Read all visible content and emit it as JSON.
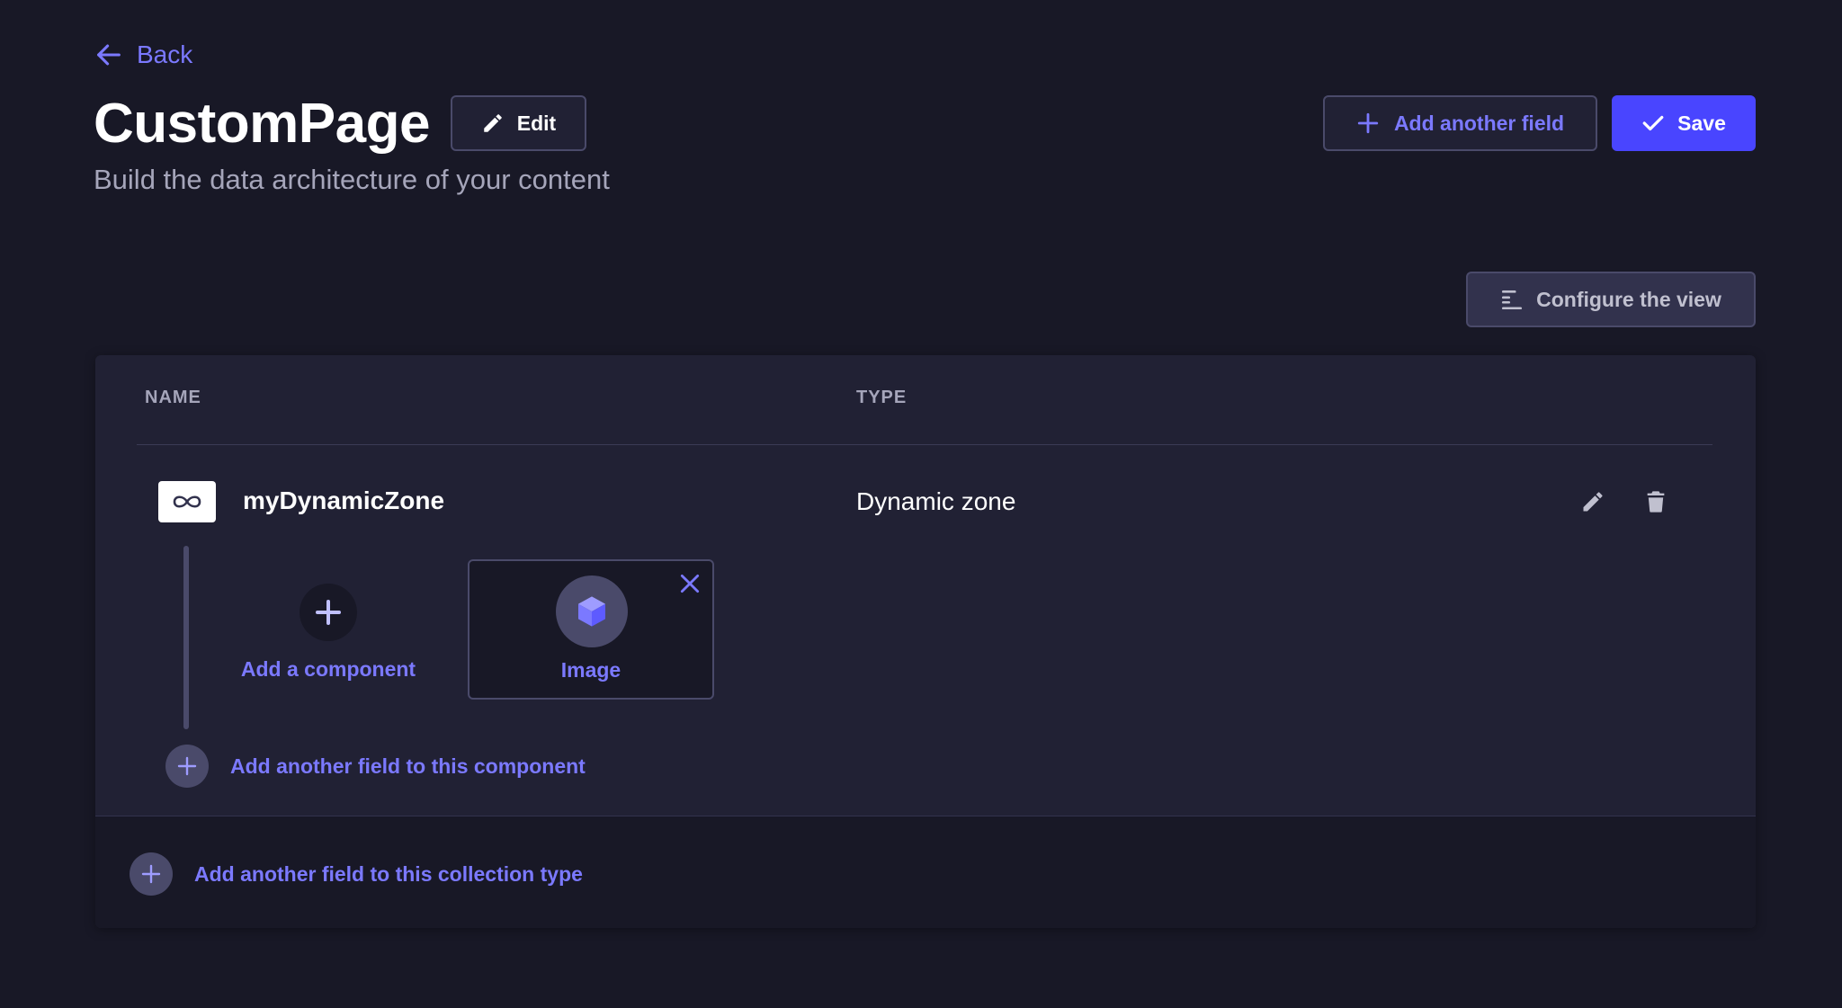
{
  "nav": {
    "back_label": "Back"
  },
  "header": {
    "title": "CustomPage",
    "subtitle": "Build the data architecture of your content",
    "edit_label": "Edit",
    "add_field_label": "Add another field",
    "save_label": "Save",
    "configure_label": "Configure the view"
  },
  "table": {
    "columns": [
      "NAME",
      "TYPE"
    ],
    "rows": [
      {
        "name": "myDynamicZone",
        "type": "Dynamic zone",
        "icon": "infinity-icon",
        "components": [
          {
            "label": "Image",
            "icon": "cube-icon"
          }
        ],
        "add_component_label": "Add a component",
        "add_field_to_component_label": "Add another field to this component"
      }
    ],
    "add_field_to_collection_label": "Add another field to this collection type"
  },
  "colors": {
    "background": "#181826",
    "surface": "#212134",
    "accent": "#4945ff",
    "accent_text": "#7b79ff",
    "muted_text": "#a5a5ba"
  }
}
